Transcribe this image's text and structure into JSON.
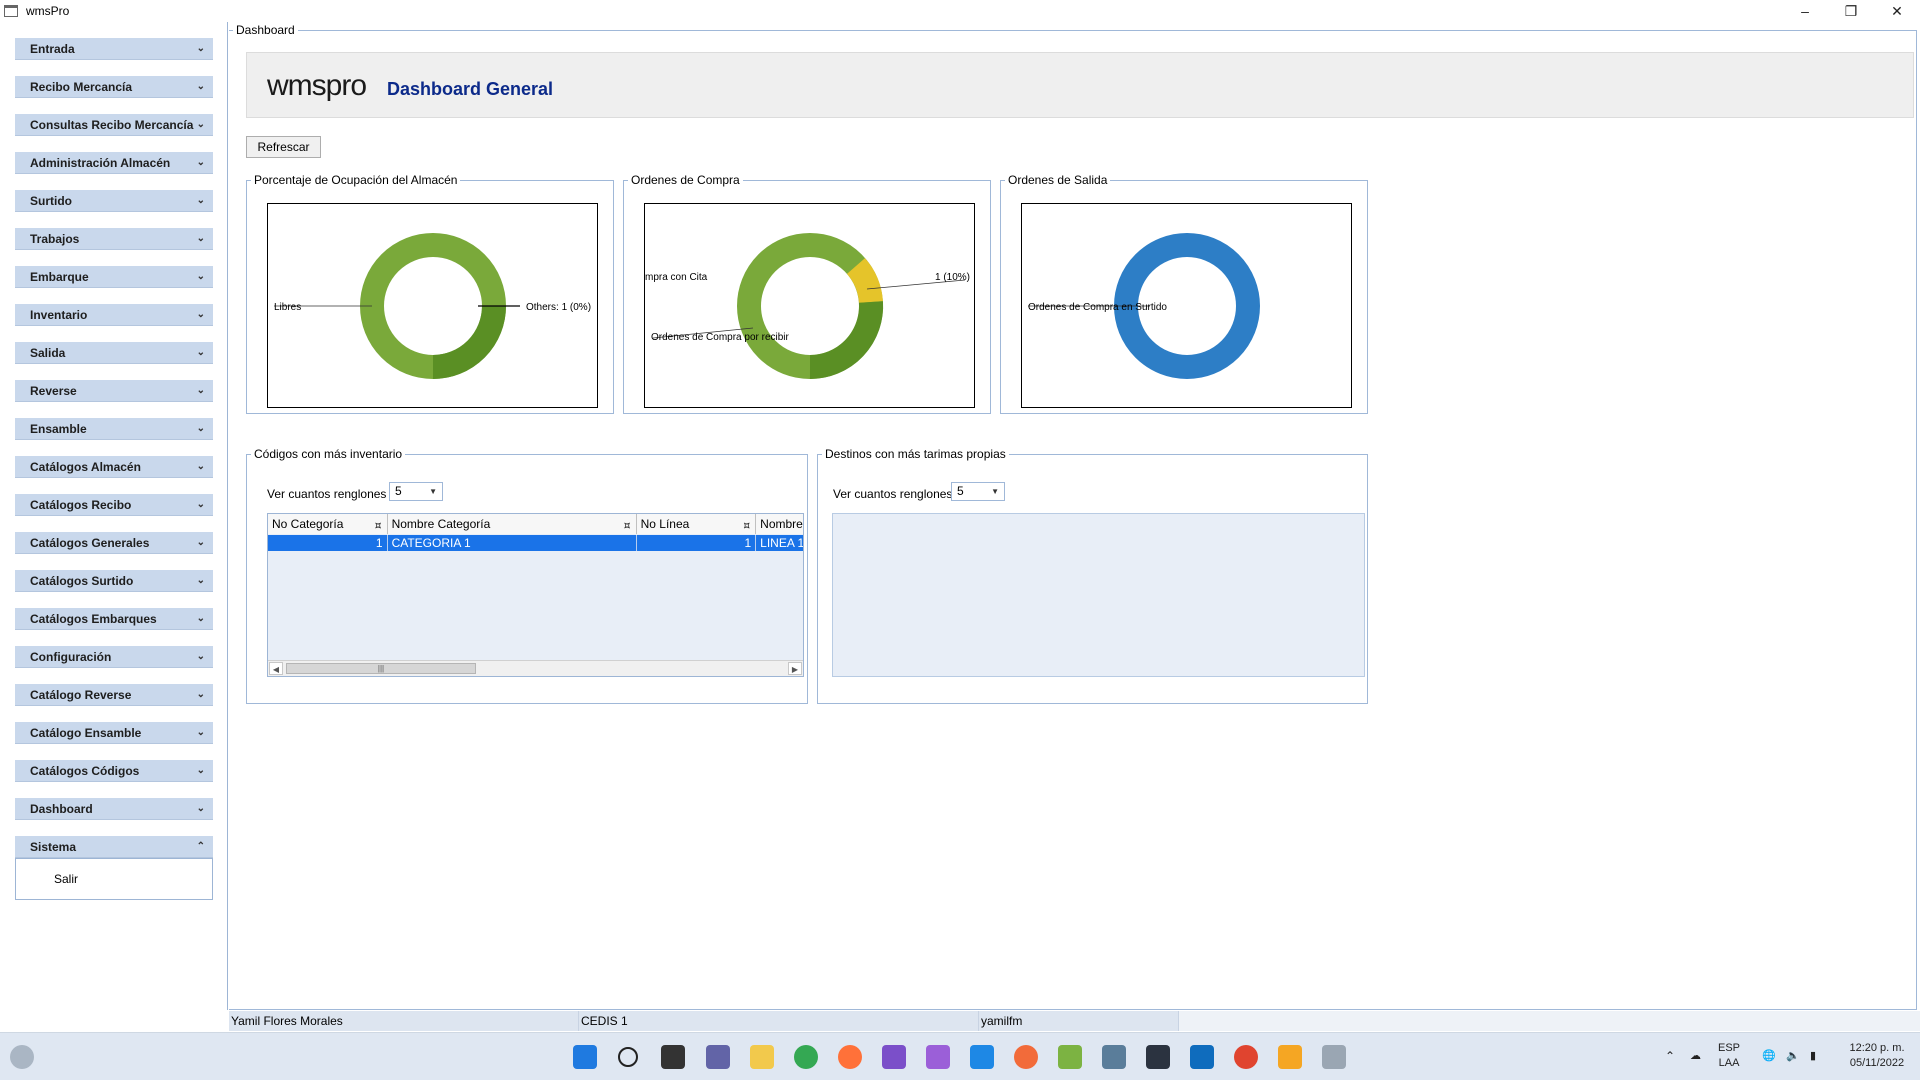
{
  "window": {
    "title": "wmsPro",
    "controls": [
      "minimize",
      "restore",
      "close"
    ]
  },
  "sidebar": {
    "items": [
      {
        "label": "Entrada"
      },
      {
        "label": "Recibo Mercancía"
      },
      {
        "label": "Consultas Recibo Mercancía"
      },
      {
        "label": "Administración Almacén"
      },
      {
        "label": "Surtido"
      },
      {
        "label": "Trabajos"
      },
      {
        "label": "Embarque"
      },
      {
        "label": "Inventario"
      },
      {
        "label": "Salida"
      },
      {
        "label": "Reverse"
      },
      {
        "label": "Ensamble"
      },
      {
        "label": "Catálogos Almacén"
      },
      {
        "label": "Catálogos Recibo"
      },
      {
        "label": "Catálogos Generales"
      },
      {
        "label": "Catálogos Surtido"
      },
      {
        "label": "Catálogos Embarques"
      },
      {
        "label": "Configuración"
      },
      {
        "label": "Catálogo Reverse"
      },
      {
        "label": "Catálogo Ensamble"
      },
      {
        "label": "Catálogos Códigos"
      },
      {
        "label": "Dashboard"
      },
      {
        "label": "Sistema"
      }
    ],
    "expanded_submenu": {
      "parent": "Sistema",
      "items": [
        "Salir"
      ]
    }
  },
  "main": {
    "group_title": "Dashboard",
    "logo_text": "wmspro",
    "page_title": "Dashboard General",
    "refresh_button": "Refrescar",
    "charts": [
      {
        "title": "Porcentaje de Ocupación del Almacén",
        "labels": [
          "Libres",
          "Others: 1 (0%)"
        ]
      },
      {
        "title": "Ordenes de Compra",
        "labels": [
          "mpra con Cita",
          "1 (10%)",
          "Ordenes de Compra por recibir"
        ]
      },
      {
        "title": "Ordenes de Salida",
        "labels": [
          "Ordenes de Compra en Surtido"
        ]
      }
    ],
    "codes_panel": {
      "title": "Códigos con más inventario",
      "rows_label": "Ver cuantos renglones",
      "rows_value": "5",
      "columns": [
        "No Categoría",
        "Nombre Categoría",
        "No Línea",
        "Nombre"
      ],
      "rows": [
        [
          "1",
          "CATEGORIA 1",
          "1",
          "LINEA 1"
        ]
      ]
    },
    "destinations_panel": {
      "title": "Destinos con más tarimas propias",
      "rows_label": "Ver cuantos renglones",
      "rows_value": "5"
    }
  },
  "statusbar": {
    "user": "Yamil Flores Morales",
    "site": "CEDIS 1",
    "login": "yamilfm"
  },
  "taskbar": {
    "lang": "ESP",
    "layout": "LAA",
    "time": "12:20 p. m.",
    "date": "05/11/2022"
  },
  "colors": {
    "menu_bg": "#c9d8ec",
    "accent": "#1a73e8",
    "title_blue": "#0c2a8a",
    "green": "#6a9e2e",
    "yellow": "#e5c42a",
    "blue": "#2d7ec6"
  }
}
